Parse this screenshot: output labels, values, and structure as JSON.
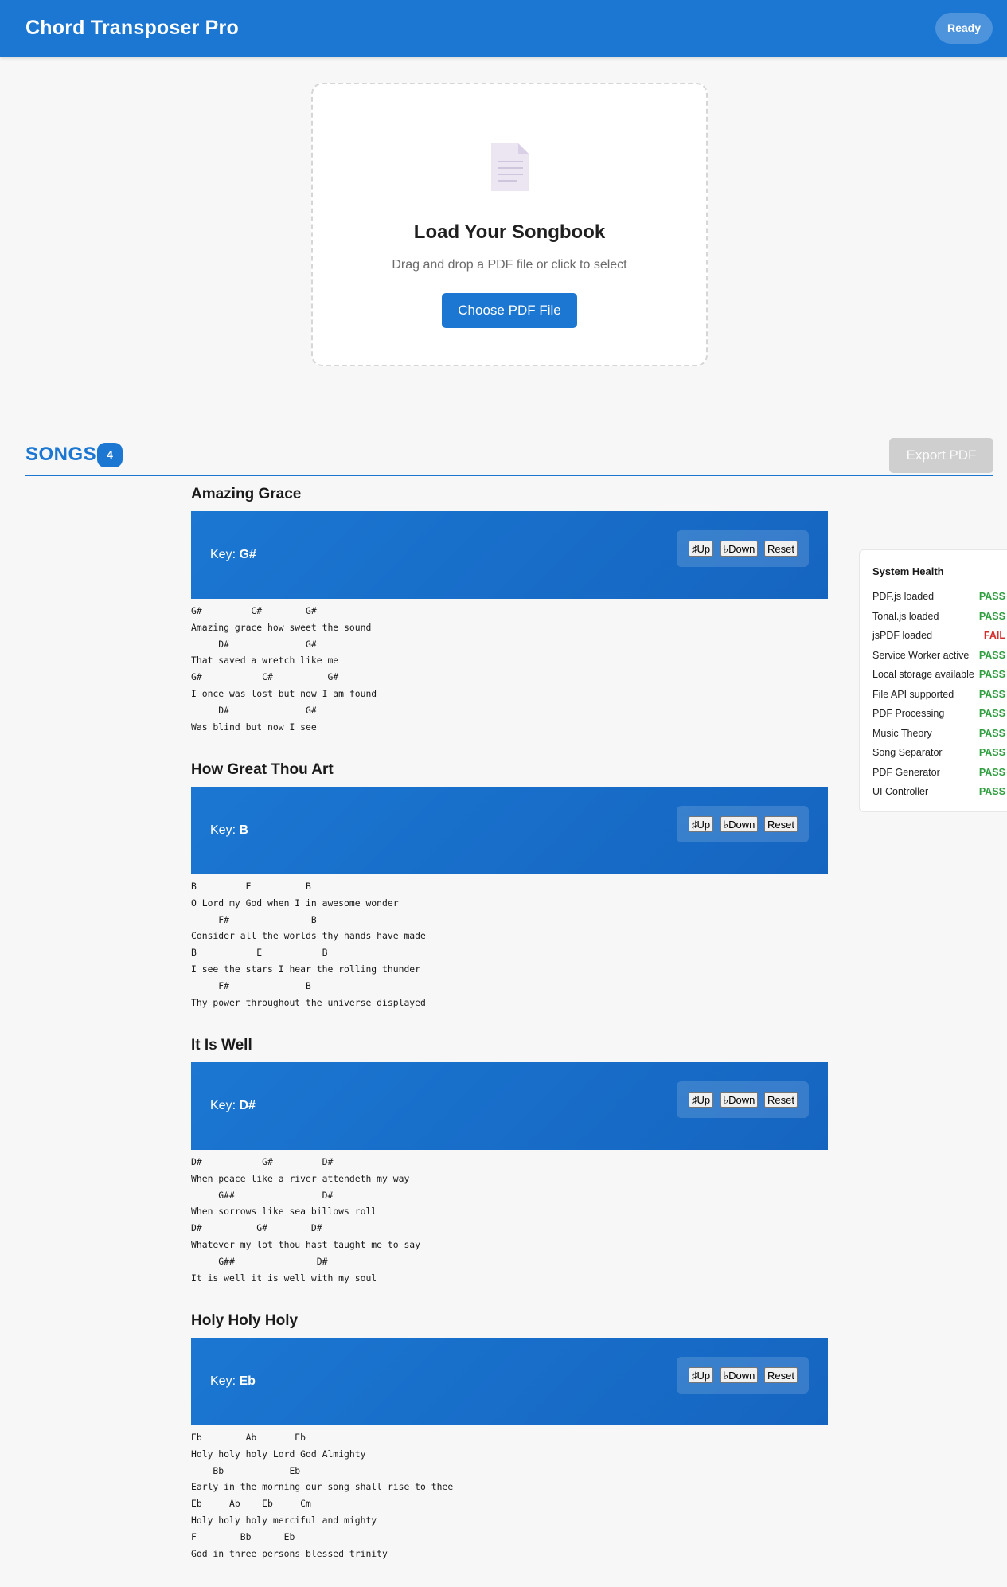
{
  "header": {
    "title": "Chord Transposer Pro",
    "status": "Ready"
  },
  "upload": {
    "icon": "document-icon",
    "title": "Load Your Songbook",
    "subtitle": "Drag and drop a PDF file or click to select",
    "button_label": "Choose PDF File"
  },
  "songs_header": {
    "heading": "SONGS",
    "count": "4",
    "export_label": "Export PDF"
  },
  "controls": {
    "up_label": "♯Up",
    "down_label": "♭Down",
    "reset_label": "Reset",
    "key_prefix": "Key: "
  },
  "songs": [
    {
      "title": "Amazing Grace",
      "key": "G#",
      "lines": [
        "G#         C#        G#",
        "Amazing grace how sweet the sound",
        "     D#              G#",
        "That saved a wretch like me",
        "G#           C#          G#",
        "I once was lost but now I am found",
        "     D#              G#",
        "Was blind but now I see"
      ]
    },
    {
      "title": "How Great Thou Art",
      "key": "B",
      "lines": [
        "B         E          B",
        "O Lord my God when I in awesome wonder",
        "     F#               B",
        "Consider all the worlds thy hands have made",
        "B           E           B",
        "I see the stars I hear the rolling thunder",
        "     F#              B",
        "Thy power throughout the universe displayed"
      ]
    },
    {
      "title": "It Is Well",
      "key": "D#",
      "lines": [
        "D#           G#         D#",
        "When peace like a river attendeth my way",
        "     G##                D#",
        "When sorrows like sea billows roll",
        "D#          G#        D#",
        "Whatever my lot thou hast taught me to say",
        "     G##               D#",
        "It is well it is well with my soul"
      ]
    },
    {
      "title": "Holy Holy Holy",
      "key": "Eb",
      "lines": [
        "Eb        Ab       Eb",
        "Holy holy holy Lord God Almighty",
        "    Bb            Eb",
        "Early in the morning our song shall rise to thee",
        "Eb     Ab    Eb     Cm",
        "Holy holy holy merciful and mighty",
        "F        Bb      Eb",
        "God in three persons blessed trinity"
      ]
    }
  ],
  "health": {
    "title": "System Health",
    "pass_color": "#2e9e3f",
    "fail_color": "#d32f2f",
    "checks": [
      {
        "name": "PDF.js loaded",
        "status": "PASS"
      },
      {
        "name": "Tonal.js loaded",
        "status": "PASS"
      },
      {
        "name": "jsPDF loaded",
        "status": "FAIL"
      },
      {
        "name": "Service Worker active",
        "status": "PASS"
      },
      {
        "name": "Local storage available",
        "status": "PASS"
      },
      {
        "name": "File API supported",
        "status": "PASS"
      },
      {
        "name": "PDF Processing",
        "status": "PASS"
      },
      {
        "name": "Music Theory",
        "status": "PASS"
      },
      {
        "name": "Song Separator",
        "status": "PASS"
      },
      {
        "name": "PDF Generator",
        "status": "PASS"
      },
      {
        "name": "UI Controller",
        "status": "PASS"
      }
    ]
  }
}
